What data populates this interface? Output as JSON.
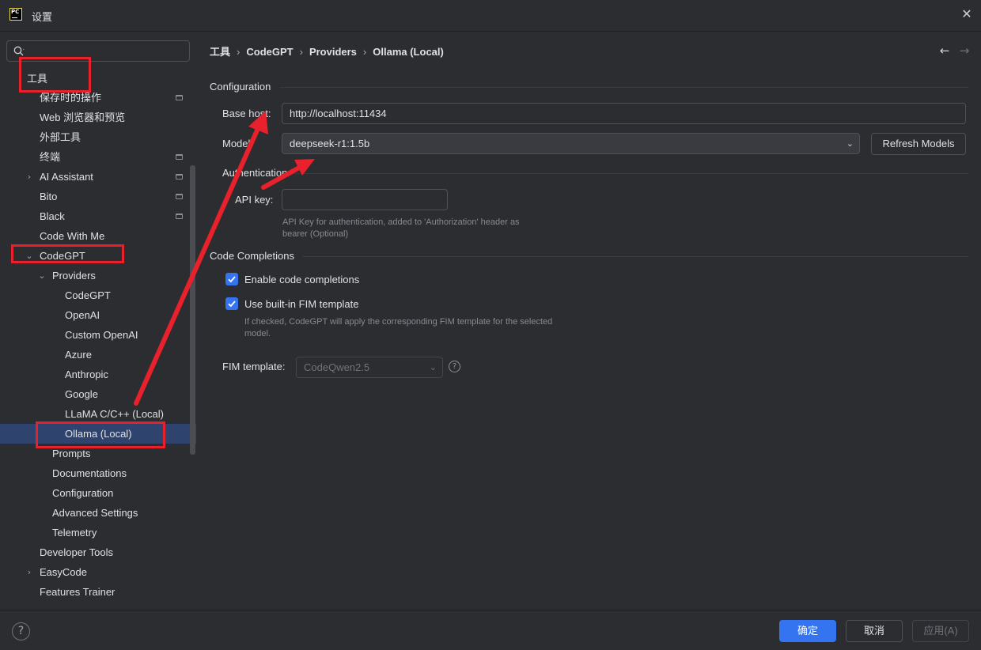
{
  "window": {
    "logo_text": "PC",
    "title": "设置",
    "close_glyph": "✕"
  },
  "search": {
    "value": "",
    "placeholder": ""
  },
  "sidebar": {
    "items": [
      {
        "label": "工具",
        "expanded": true,
        "chevron": "",
        "project_icon": false
      },
      {
        "label": "保存时的操作",
        "chevron": "",
        "project_icon": true
      },
      {
        "label": "Web 浏览器和预览",
        "chevron": "",
        "project_icon": false
      },
      {
        "label": "外部工具",
        "chevron": "",
        "project_icon": false
      },
      {
        "label": "终端",
        "chevron": "",
        "project_icon": true
      },
      {
        "label": "AI Assistant",
        "chevron": "›",
        "project_icon": true
      },
      {
        "label": "Bito",
        "chevron": "",
        "project_icon": true
      },
      {
        "label": "Black",
        "chevron": "",
        "project_icon": true
      },
      {
        "label": "Code With Me",
        "chevron": "",
        "project_icon": false
      },
      {
        "label": "CodeGPT",
        "chevron": "⌄",
        "project_icon": false
      },
      {
        "label": "Providers",
        "chevron": "⌄",
        "project_icon": false
      },
      {
        "label": "CodeGPT",
        "chevron": "",
        "project_icon": false
      },
      {
        "label": "OpenAI",
        "chevron": "",
        "project_icon": false
      },
      {
        "label": "Custom OpenAI",
        "chevron": "",
        "project_icon": false
      },
      {
        "label": "Azure",
        "chevron": "",
        "project_icon": false
      },
      {
        "label": "Anthropic",
        "chevron": "",
        "project_icon": false
      },
      {
        "label": "Google",
        "chevron": "",
        "project_icon": false
      },
      {
        "label": "LLaMA C/C++ (Local)",
        "chevron": "",
        "project_icon": false
      },
      {
        "label": "Ollama (Local)",
        "chevron": "",
        "project_icon": false,
        "selected": true
      },
      {
        "label": "Prompts",
        "chevron": "",
        "project_icon": false
      },
      {
        "label": "Documentations",
        "chevron": "",
        "project_icon": false
      },
      {
        "label": "Configuration",
        "chevron": "",
        "project_icon": false
      },
      {
        "label": "Advanced Settings",
        "chevron": "",
        "project_icon": false
      },
      {
        "label": "Telemetry",
        "chevron": "",
        "project_icon": false
      },
      {
        "label": "Developer Tools",
        "chevron": "",
        "project_icon": false
      },
      {
        "label": "EasyCode",
        "chevron": "›",
        "project_icon": false
      },
      {
        "label": "Features Trainer",
        "chevron": "",
        "project_icon": false
      }
    ]
  },
  "breadcrumb": {
    "items": [
      "工具",
      "CodeGPT",
      "Providers",
      "Ollama (Local)"
    ],
    "separator": "›",
    "back_glyph": "←",
    "forward_glyph": "→"
  },
  "configuration": {
    "section_title": "Configuration",
    "base_host_label": "Base host:",
    "base_host_value": "http://localhost:11434",
    "model_label": "Model:",
    "model_value": "deepseek-r1:1.5b",
    "refresh_button": "Refresh Models"
  },
  "authentication": {
    "section_title": "Authentication",
    "api_key_label": "API key:",
    "api_key_value": "",
    "api_key_hint_line1": "API Key for authentication, added to 'Authorization' header as",
    "api_key_hint_line2": "bearer (Optional)"
  },
  "code_completions": {
    "section_title": "Code Completions",
    "enable_label": "Enable code completions",
    "enable_checked": true,
    "fim_label": "Use built-in FIM template",
    "fim_checked": true,
    "fim_hint_line1": "If checked, CodeGPT will apply the corresponding FIM template for the selected",
    "fim_hint_line2": "model.",
    "fim_template_label": "FIM template:",
    "fim_template_value": "CodeQwen2.5",
    "help_glyph": "?"
  },
  "footer": {
    "help_glyph": "?",
    "ok_button": "确定",
    "cancel_button": "取消",
    "apply_button": "应用(A)"
  },
  "colors": {
    "background": "#2b2d30",
    "selection": "#2e436e",
    "accent": "#3574f0",
    "annotation_red": "#e8212c"
  }
}
